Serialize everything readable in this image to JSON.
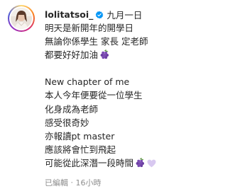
{
  "post": {
    "username": "lolitatsoi_",
    "date": "九月一日",
    "lines": [
      "明天是新開年的開學日",
      "無論你係學生 家長 定老師",
      "都要好好加油",
      "",
      "New chapter of me",
      "本人今年便要從一位學生",
      "化身成為老師",
      "感受很奇妙",
      "亦報讀pt master",
      "應該將會忙到飛起",
      "可能從此深潛一段時間"
    ],
    "edited_label": "已編輯",
    "separator": "·",
    "time_ago": "16小時",
    "icons": {
      "verified": "verified-badge-icon",
      "grapes": "grapes-emoji",
      "heart": "light-purple-heart-emoji"
    },
    "colors": {
      "verified": "#0095f6",
      "grapes": "#7b4bb3",
      "heart": "#d8c8f0",
      "meta_text": "#8e8e8e"
    }
  }
}
